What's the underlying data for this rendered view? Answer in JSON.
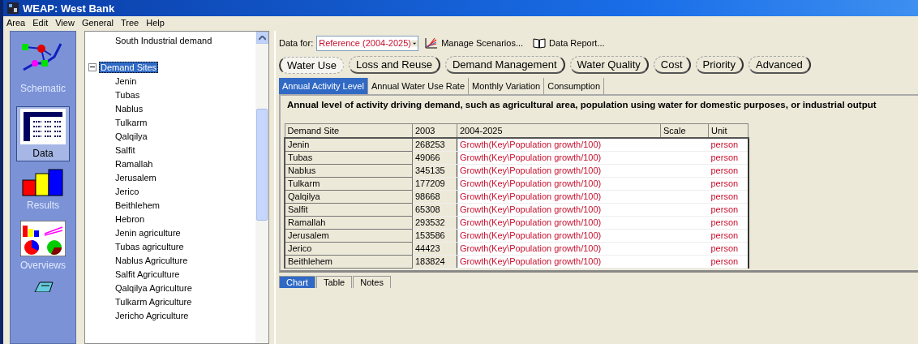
{
  "window": {
    "title": "WEAP: West Bank"
  },
  "menu": [
    "Area",
    "Edit",
    "View",
    "General",
    "Tree",
    "Help"
  ],
  "views": [
    {
      "label": "Schematic",
      "kind": "schematic",
      "selected": false
    },
    {
      "label": "Data",
      "kind": "data",
      "selected": true
    },
    {
      "label": "Results",
      "kind": "results",
      "selected": false
    },
    {
      "label": "Overviews",
      "kind": "overviews",
      "selected": false
    },
    {
      "kind": "notes",
      "selected": false
    }
  ],
  "tree": [
    {
      "label": "South Industrial demand",
      "selected": false
    },
    {
      "label": "Demand Sites",
      "selected": true,
      "expanded": true,
      "children": [
        {
          "label": "Jenin"
        },
        {
          "label": "Tubas"
        },
        {
          "label": "Nablus"
        },
        {
          "label": "Tulkarm"
        },
        {
          "label": "Qalqilya"
        },
        {
          "label": "Salfit"
        },
        {
          "label": "Ramallah"
        },
        {
          "label": "Jerusalem"
        },
        {
          "label": "Jerico"
        },
        {
          "label": "Beithlehem"
        },
        {
          "label": "Hebron"
        },
        {
          "label": "Jenin agriculture"
        },
        {
          "label": "Tubas agriculture"
        },
        {
          "label": "Nablus Agriculture"
        },
        {
          "label": "Salfit Agriculture"
        },
        {
          "label": "Qalqilya Agriculture"
        },
        {
          "label": "Tulkarm Agriculture"
        },
        {
          "label": "Jericho Agriculture"
        }
      ]
    }
  ],
  "toolbar": {
    "data_for_label": "Data for:",
    "scenario": "Reference (2004-2025)",
    "buttons": [
      {
        "label": "Manage Scenarios...",
        "kind": "chart"
      },
      {
        "label": "Data Report...",
        "kind": "book"
      }
    ]
  },
  "category_tabs": [
    {
      "label": "Water Use",
      "selected": true
    },
    {
      "label": "Loss and Reuse",
      "selected": false
    },
    {
      "label": "Demand Management",
      "selected": false
    },
    {
      "label": "Water Quality",
      "selected": false
    },
    {
      "label": "Cost",
      "selected": false
    },
    {
      "label": "Priority",
      "selected": false
    },
    {
      "label": "Advanced",
      "selected": false
    }
  ],
  "sub_tabs": [
    {
      "label": "Annual Activity Level",
      "selected": true
    },
    {
      "label": "Annual Water Use Rate",
      "selected": false
    },
    {
      "label": "Monthly Variation",
      "selected": false
    },
    {
      "label": "Consumption",
      "selected": false
    }
  ],
  "description": "Annual level of activity driving demand, such as agricultural area, population using water for domestic purposes, or industrial output",
  "table": {
    "columns": [
      "Demand Site",
      "2003",
      "2004-2025",
      "Scale",
      "Unit"
    ],
    "rows": [
      [
        "Jenin",
        "268253",
        "Growth(Key\\Population growth/100)",
        "",
        "person"
      ],
      [
        "Tubas",
        "49066",
        "Growth(Key\\Population growth/100)",
        "",
        "person"
      ],
      [
        "Nablus",
        "345135",
        "Growth(Key\\Population growth/100)",
        "",
        "person"
      ],
      [
        "Tulkarm",
        "177209",
        "Growth(Key\\Population growth/100)",
        "",
        "person"
      ],
      [
        "Qalqilya",
        "98668",
        "Growth(Key\\Population growth/100)",
        "",
        "person"
      ],
      [
        "Salfit",
        "65308",
        "Growth(Key\\Population growth/100)",
        "",
        "person"
      ],
      [
        "Ramallah",
        "293532",
        "Growth(Key\\Population growth/100)",
        "",
        "person"
      ],
      [
        "Jerusalem",
        "153586",
        "Growth(Key\\Population growth/100)",
        "",
        "person"
      ],
      [
        "Jerico",
        "44423",
        "Growth(Key\\Population growth/100)",
        "",
        "person"
      ],
      [
        "Beithlehem",
        "183824",
        "Growth(Key\\Population growth/100)",
        "",
        "person"
      ]
    ]
  },
  "bottom_tabs": [
    {
      "label": "Chart",
      "selected": true
    },
    {
      "label": "Table",
      "selected": false
    },
    {
      "label": "Notes",
      "selected": false
    }
  ]
}
